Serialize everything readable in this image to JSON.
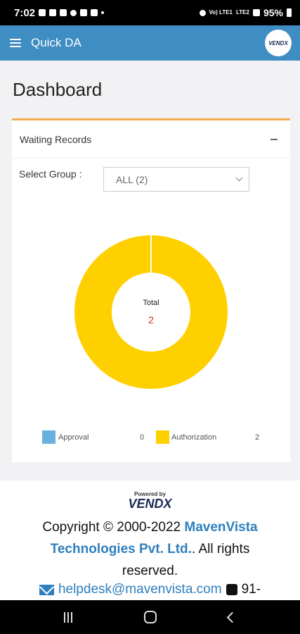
{
  "status_bar": {
    "time": "7:02",
    "battery": "95%",
    "network": "Vo) LTE1",
    "network2": "LTE2"
  },
  "app_bar": {
    "title": "Quick DA",
    "avatar_text": "VENDX"
  },
  "page": {
    "title": "Dashboard"
  },
  "card": {
    "title": "Waiting Records",
    "select_label": "Select Group :",
    "select_value": "ALL (2)"
  },
  "chart_data": {
    "type": "pie",
    "center_label": "Total",
    "center_value": "2",
    "categories": [
      "Approval",
      "Authorization"
    ],
    "values": [
      0,
      2
    ],
    "colors": [
      "#6ab0de",
      "#ffd000"
    ]
  },
  "legend": [
    {
      "label": "Approval",
      "value": "0"
    },
    {
      "label": "Authorization",
      "value": "2"
    }
  ],
  "footer": {
    "powered_by": "Powered by",
    "logo_text": "VENDX",
    "copyright_prefix": "Copyright © 2000-2022 ",
    "company": "MavenVista Technologies Pvt. Ltd.",
    "copyright_suffix": ". All rights reserved.",
    "email": "helpdesk@mavenvista.com",
    "phone": "91-"
  },
  "colors": {
    "app_bar": "#3e8dc3",
    "accent": "#f0ad4e",
    "link": "#2e7fbd",
    "total_value": "#c9302c"
  },
  "icons": [
    "menu-icon",
    "collapse-icon",
    "chevron-down-icon",
    "mail-icon",
    "phone-icon"
  ]
}
